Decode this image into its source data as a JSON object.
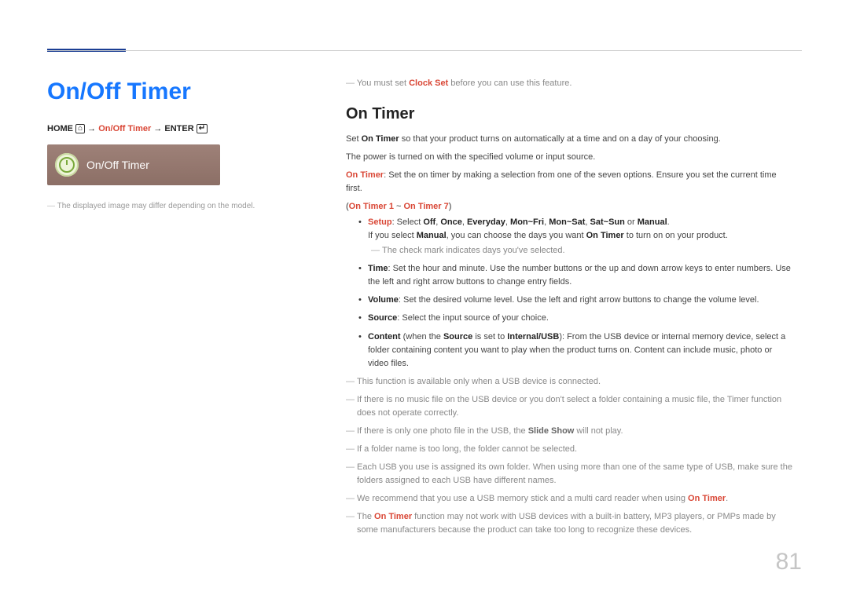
{
  "page_number": "81",
  "title": "On/Off Timer",
  "breadcrumb": {
    "home": "HOME",
    "path": "On/Off Timer",
    "enter": "ENTER",
    "arrow": "→",
    "home_icon": "⌂",
    "enter_icon": "↵"
  },
  "thumb_label": "On/Off Timer",
  "left_note": "The displayed image may differ depending on the model.",
  "pre_note_a": "You must set ",
  "pre_note_emph": "Clock Set",
  "pre_note_b": " before you can use this feature.",
  "section_title": "On Timer",
  "p1_a": "Set ",
  "p1_emph": "On Timer",
  "p1_b": " so that your product turns on automatically at a time and on a day of your choosing.",
  "p2": "The power is turned on with the specified volume or input source.",
  "p3_label": "On Timer",
  "p3_text": ": Set the on timer by making a selection from one of the seven options. Ensure you set the current time first.",
  "paren_a": "(",
  "paren_emph": "On Timer 1",
  "paren_mid": " ~ ",
  "paren_emph2": "On Timer 7",
  "paren_b": ")",
  "setup_label": "Setup",
  "setup_sel": ": Select ",
  "opt_off": "Off",
  "opt_once": "Once",
  "opt_every": "Everyday",
  "opt_monfri": "Mon~Fri",
  "opt_monsat": "Mon~Sat",
  "opt_satsun": "Sat~Sun",
  "opt_or": " or ",
  "opt_manual": "Manual",
  "comma": ", ",
  "period": ".",
  "setup_line2_a": "If you select ",
  "setup_line2_b": ", you can choose the days you want ",
  "setup_line2_c": " to turn on on your product.",
  "setup_sub": "The check mark indicates days you've selected.",
  "time_label": "Time",
  "time_text": ": Set the hour and minute. Use the number buttons or the up and down arrow keys to enter numbers. Use the left and right arrow buttons to change entry fields.",
  "volume_label": "Volume",
  "volume_text": ": Set the desired volume level. Use the left and right arrow buttons to change the volume level.",
  "source_label": "Source",
  "source_text": ": Select the input source of your choice.",
  "content_label": "Content",
  "content_when_a": " (when the ",
  "content_src": "Source",
  "content_when_b": " is set to ",
  "content_internal": "Internal/USB",
  "content_when_c": "): From the USB device or internal memory device, select a folder containing content you want to play when the product turns on. Content can include music, photo or video files.",
  "n1": "This function is available only when a USB device is connected.",
  "n2": "If there is no music file on the USB device or you don't select a folder containing a music file, the Timer function does not operate correctly.",
  "n3_a": "If there is only one photo file in the USB, the ",
  "n3_emph": "Slide Show",
  "n3_b": " will not play.",
  "n4": "If a folder name is too long, the folder cannot be selected.",
  "n5": "Each USB you use is assigned its own folder. When using more than one of the same type of USB, make sure the folders assigned to each USB have different names.",
  "n6_a": "We recommend that you use a USB memory stick and a multi card reader when using ",
  "n6_emph": "On Timer",
  "n6_b": ".",
  "n7_a": "The ",
  "n7_emph": "On Timer",
  "n7_b": " function may not work with USB devices with a built-in battery, MP3 players, or PMPs made by some manufacturers because the product can take too long to recognize these devices."
}
